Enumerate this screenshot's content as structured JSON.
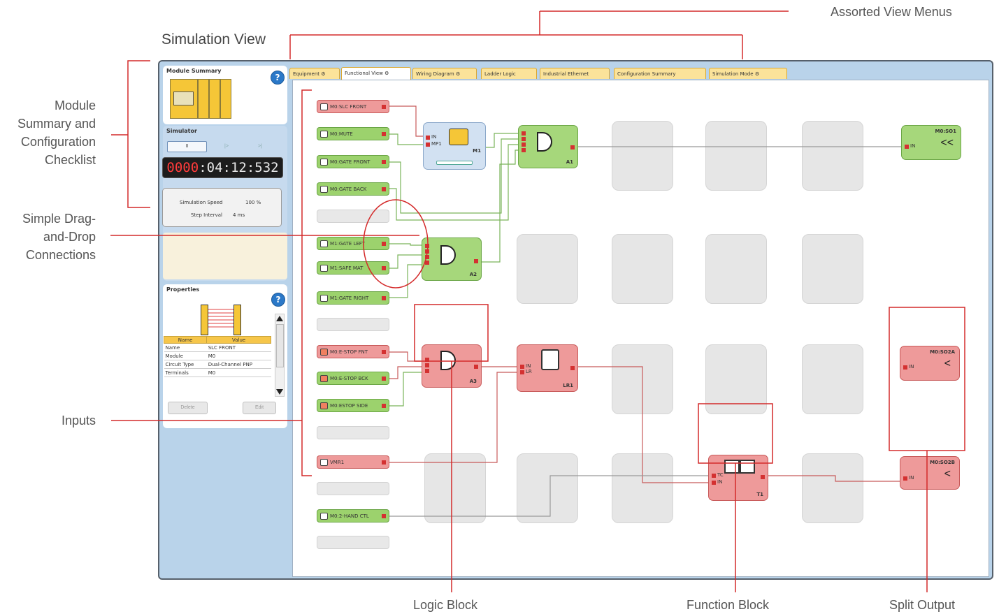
{
  "callouts": {
    "assorted_view_menus": "Assorted View Menus",
    "simulation_view": "Simulation View",
    "module_summary": [
      "Module",
      "Summary and",
      "Configuration",
      "Checklist"
    ],
    "drag_drop": [
      "Simple Drag-",
      "and-Drop",
      "Connections"
    ],
    "inputs": "Inputs",
    "logic_block": "Logic Block",
    "function_block": "Function Block",
    "split_output": "Split Output"
  },
  "left": {
    "module_summary_title": "Module Summary",
    "simulator_title": "Simulator",
    "buttons": [
      "II",
      "|>",
      ">|"
    ],
    "timer": {
      "part1": "0000",
      "part2": ":04:12:532"
    },
    "speed_label": "Simulation Speed",
    "speed_value": "100 %",
    "step_label": "Step Interval",
    "step_value": "4 ms",
    "properties_title": "Properties",
    "prop_headers": [
      "Name",
      "Value"
    ],
    "prop_rows": [
      [
        "Name",
        "SLC FRONT"
      ],
      [
        "Module",
        "M0"
      ],
      [
        "Circuit Type",
        "Dual-Channel PNP"
      ],
      [
        "Terminals",
        "M0"
      ]
    ],
    "delete_label": "Delete",
    "edit_label": "Edit",
    "help_glyph": "?"
  },
  "tabs": [
    "Equipment",
    "Functional View",
    "Wiring Diagram",
    "Ladder Logic",
    "Industrial Ethernet",
    "Configuration Summary",
    "Simulation Mode"
  ],
  "inputs": [
    {
      "label": "M0:SLC FRONT",
      "color": "red"
    },
    {
      "label": "M0:MUTE",
      "color": "green"
    },
    {
      "label": "M0:GATE FRONT",
      "color": "green"
    },
    {
      "label": "M0:GATE BACK",
      "color": "green"
    },
    {
      "label": "",
      "color": "empty"
    },
    {
      "label": "M1:GATE LEFT",
      "color": "green"
    },
    {
      "label": "M1:SAFE MAT",
      "color": "green"
    },
    {
      "label": "M1:GATE RIGHT",
      "color": "green"
    },
    {
      "label": "",
      "color": "empty"
    },
    {
      "label": "M0:E-STOP FNT",
      "color": "red"
    },
    {
      "label": "M0:E-STOP BCK",
      "color": "green"
    },
    {
      "label": "M0:ESTOP SIDE",
      "color": "green"
    },
    {
      "label": "",
      "color": "empty"
    },
    {
      "label": "VMR1",
      "color": "red"
    },
    {
      "label": "",
      "color": "empty"
    },
    {
      "label": "M0:2-HAND CTL",
      "color": "green"
    },
    {
      "label": "",
      "color": "empty"
    }
  ],
  "blocks": {
    "m1": {
      "label": "M1",
      "pin_in": "IN",
      "pin_mp": "MP1"
    },
    "a1": {
      "label": "A1"
    },
    "a2": {
      "label": "A2"
    },
    "a3": {
      "label": "A3"
    },
    "lr1": {
      "label": "LR1",
      "pin_in": "IN",
      "pin_lr": "LR"
    },
    "t1": {
      "label": "T1",
      "pin_tc": "TC",
      "pin_in": "IN"
    },
    "so1": {
      "label": "M0:SO1",
      "pin": "IN"
    },
    "so2a": {
      "label": "M0:SO2A",
      "pin": "IN"
    },
    "so2b": {
      "label": "M0:SO2B",
      "pin": "IN"
    }
  },
  "colors": {
    "accent_red": "#d42a2a",
    "active_green": "#9cd26d",
    "tripped_red": "#ee9a9a",
    "app_bg": "#b9d3ea"
  }
}
